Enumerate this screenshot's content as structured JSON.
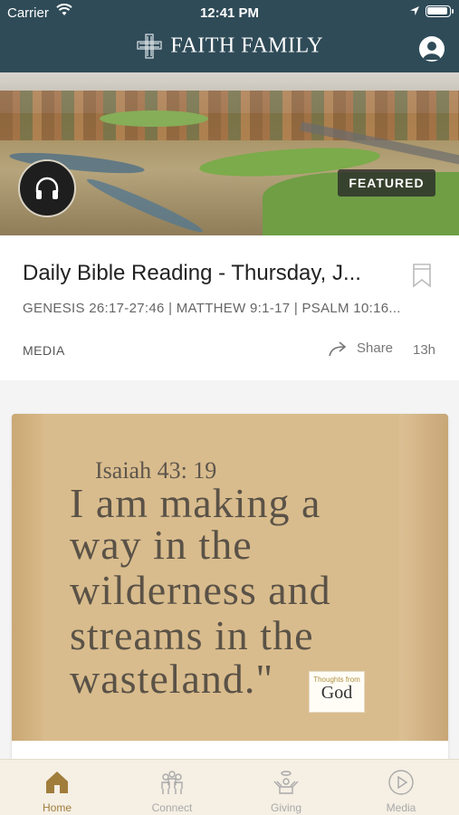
{
  "status_bar": {
    "carrier": "Carrier",
    "time": "12:41 PM"
  },
  "header": {
    "brand": "FAITH FAMILY",
    "logo_icon": "cross-logo-icon",
    "profile_icon": "profile-icon"
  },
  "featured": {
    "badge": "FEATURED",
    "media_icon": "headphones-icon",
    "title": "Daily Bible Reading - Thursday, J...",
    "subtitle": "GENESIS 26:17-27:46 | MATTHEW 9:1-17 | PSALM 10:16...",
    "category": "MEDIA",
    "share_label": "Share",
    "age": "13h"
  },
  "post": {
    "reference": "Isaiah 43: 19",
    "lines": [
      "I am making a",
      "way in the",
      "wilderness and",
      "streams in the",
      "wasteland.\""
    ],
    "logo_small": "Thoughts from",
    "logo_text": "God"
  },
  "tabs": [
    {
      "label": "Home",
      "icon": "home-icon",
      "active": true
    },
    {
      "label": "Connect",
      "icon": "people-icon",
      "active": false
    },
    {
      "label": "Giving",
      "icon": "giving-hands-icon",
      "active": false
    },
    {
      "label": "Media",
      "icon": "play-circle-icon",
      "active": false
    }
  ],
  "colors": {
    "header": "#2f4b58",
    "accent": "#a17d3c",
    "tabbar": "#f5efe4"
  }
}
